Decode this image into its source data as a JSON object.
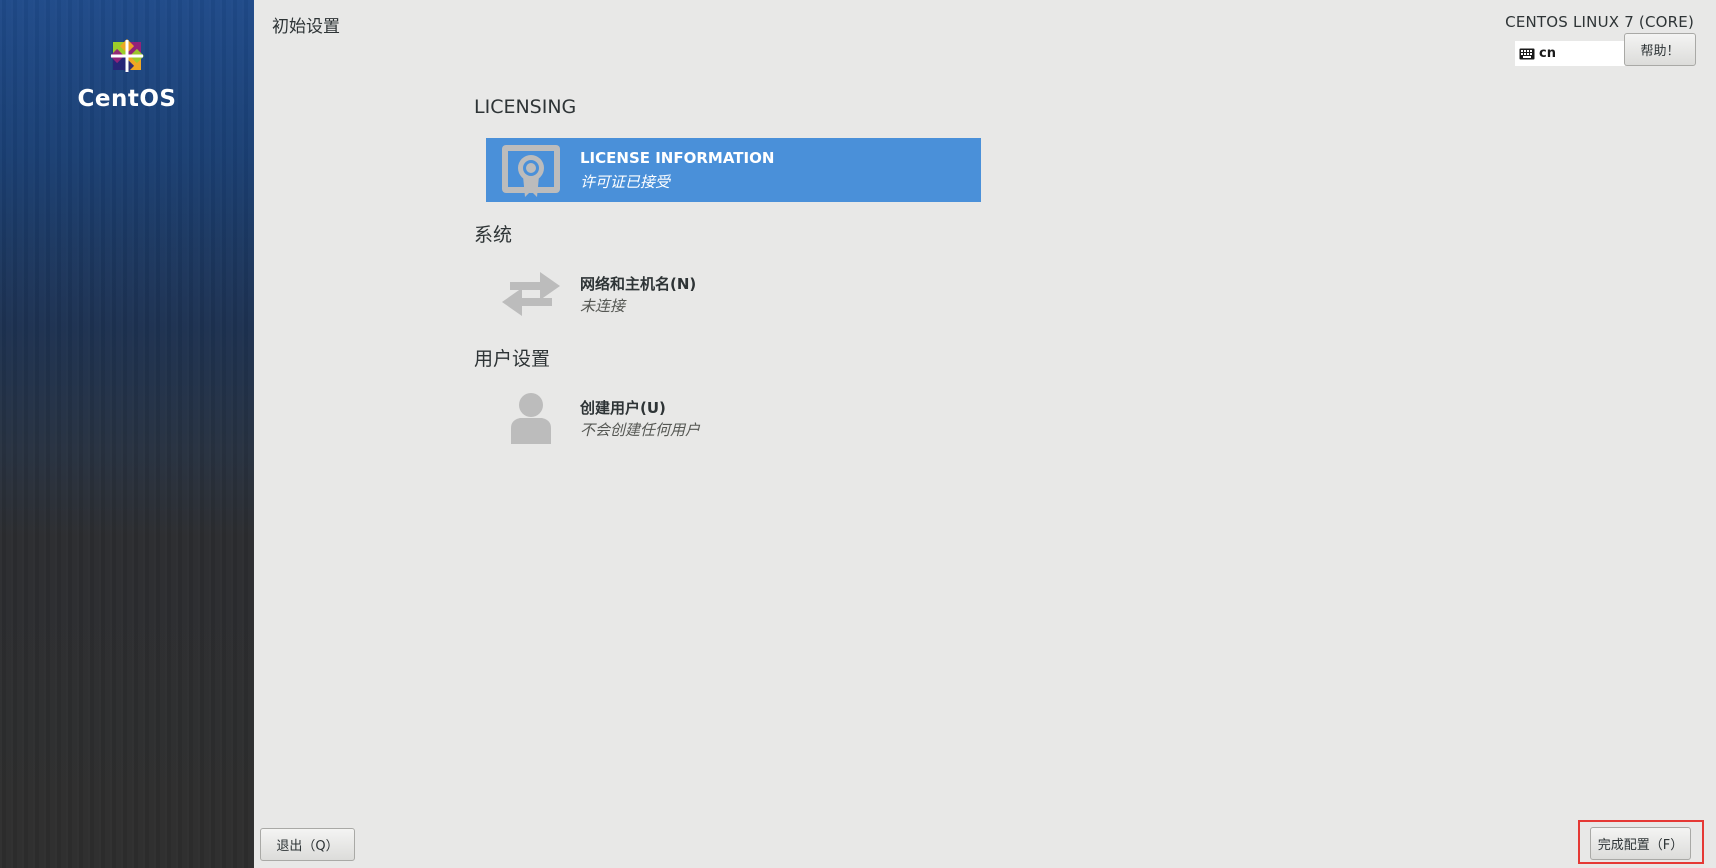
{
  "sidebar": {
    "logo_text": "CentOS"
  },
  "header": {
    "page_title": "初始设置",
    "product_title": "CENTOS LINUX 7 (CORE)",
    "keyboard_layout": "cn",
    "help_label": "帮助！"
  },
  "sections": [
    {
      "title": "LICENSING",
      "spokes": [
        {
          "title": "LICENSE INFORMATION",
          "status": "许可证已接受",
          "icon": "license-icon",
          "selected": true
        }
      ]
    },
    {
      "title": "系统",
      "spokes": [
        {
          "title": "网络和主机名(N)",
          "status": "未连接",
          "icon": "network-arrows-icon",
          "selected": false
        }
      ]
    },
    {
      "title": "用户设置",
      "spokes": [
        {
          "title": "创建用户(U)",
          "status": "不会创建任何用户",
          "icon": "user-icon",
          "selected": false
        }
      ]
    }
  ],
  "footer": {
    "quit_label": "退出（Q）",
    "finish_label": "完成配置（F）"
  },
  "colors": {
    "selected_spoke": "#4a90d9",
    "highlight_box": "#e53935",
    "background": "#e8e8e7"
  }
}
